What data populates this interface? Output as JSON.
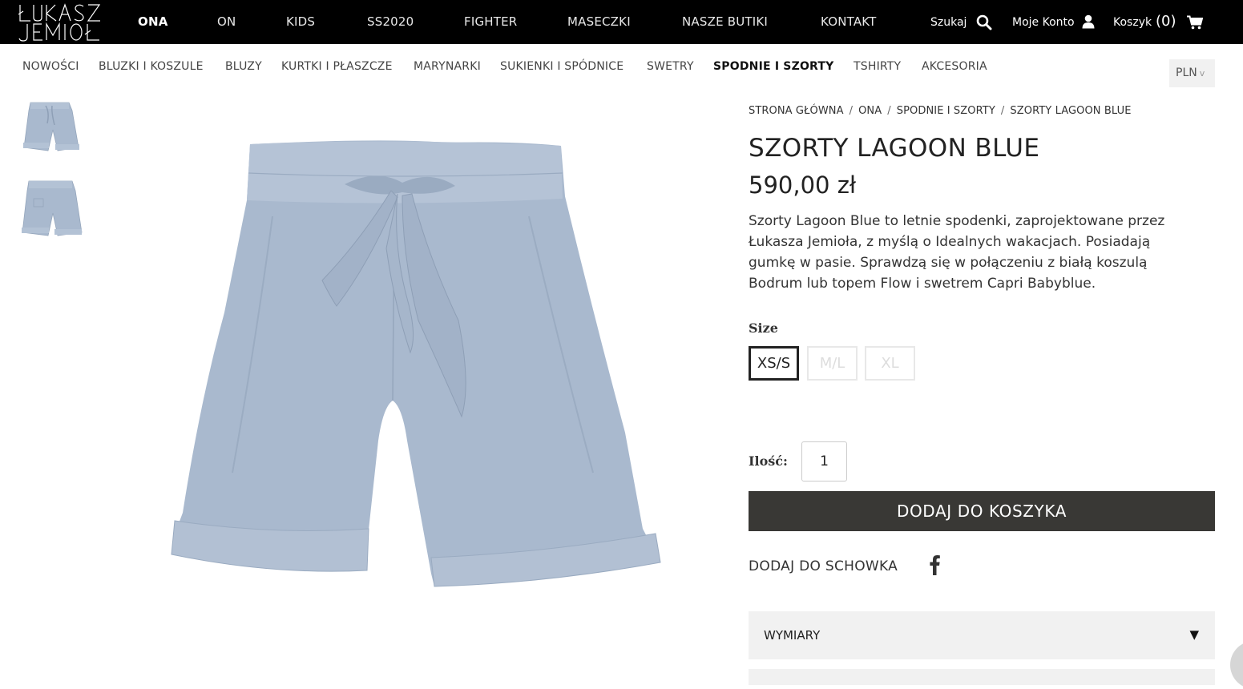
{
  "brand": {
    "logo_text": "ŁUKASZ JEMIOŁ"
  },
  "main_nav": [
    {
      "label": "ONA",
      "active": true
    },
    {
      "label": "ON"
    },
    {
      "label": "KIDS"
    },
    {
      "label": "SS2020"
    },
    {
      "label": "FIGHTER"
    },
    {
      "label": "MASECZKI"
    },
    {
      "label": "NASZE BUTIKI"
    },
    {
      "label": "KONTAKT"
    }
  ],
  "tools": {
    "search": "Szukaj",
    "account": "Moje Konto",
    "cart": "Koszyk",
    "cart_count": "(0)"
  },
  "sub_nav": [
    {
      "label": "NOWOŚCI"
    },
    {
      "label": "BLUZKI I KOSZULE"
    },
    {
      "label": "BLUZY"
    },
    {
      "label": "KURTKI I PŁASZCZE"
    },
    {
      "label": "MARYNARKI"
    },
    {
      "label": "SUKIENKI I SPÓDNICE"
    },
    {
      "label": "SWETRY"
    },
    {
      "label": "SPODNIE I SZORTY",
      "active": true
    },
    {
      "label": "TSHIRTY"
    },
    {
      "label": "AKCESORIA"
    }
  ],
  "currency": {
    "value": "PLN",
    "caret": "v"
  },
  "breadcrumb": [
    "STRONA GŁÓWNA",
    "ONA",
    "SPODNIE I SZORTY",
    "SZORTY LAGOON BLUE"
  ],
  "product": {
    "title": "SZORTY LAGOON BLUE",
    "price": "590,00 zł",
    "description": "Szorty Lagoon Blue to letnie spodenki, zaprojektowane przez Łukasza Jemioła, z myślą o Idealnych wakacjach. Posiadają gumkę w pasie. Sprawdzą się w połączeniu z białą koszulą Bodrum lub topem Flow i swetrem Capri Babyblue.",
    "size_label": "Size",
    "sizes": [
      {
        "label": "XS/S",
        "state": "selected"
      },
      {
        "label": "M/L",
        "state": "unavailable"
      },
      {
        "label": "XL",
        "state": "unavailable"
      }
    ],
    "quantity_label": "Ilość:",
    "quantity": "1",
    "add_to_cart": "DODAJ DO KOSZYKA",
    "wishlist": "DODAJ DO SCHOWKA",
    "accordion_title": "WYMIARY",
    "accordion_arrow": "▼",
    "color": "#a9b9ce"
  }
}
